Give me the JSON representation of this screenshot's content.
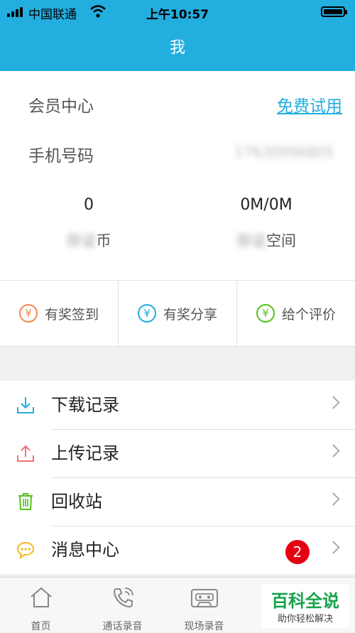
{
  "status": {
    "carrier": "中国联通",
    "time": "上午10:57"
  },
  "nav": {
    "title": "我"
  },
  "profile": {
    "member_label": "会员中心",
    "member_link": "免费试用",
    "phone_label": "手机号码",
    "phone_value": "17630996805",
    "coins": {
      "value": "0",
      "label_blur": "存证",
      "label": "币"
    },
    "space": {
      "value": "0M/0M",
      "label_blur": "存证",
      "label": "空间"
    }
  },
  "actions": [
    {
      "label": "有奖签到",
      "color": "#f08a4b"
    },
    {
      "label": "有奖分享",
      "color": "#23aee0"
    },
    {
      "label": "给个评价",
      "color": "#52c41a"
    }
  ],
  "menu": [
    {
      "label": "下载记录",
      "icon": "download-icon",
      "color": "#23aee0"
    },
    {
      "label": "上传记录",
      "icon": "upload-icon",
      "color": "#f0707a"
    },
    {
      "label": "回收站",
      "icon": "trash-icon",
      "color": "#52c41a"
    },
    {
      "label": "消息中心",
      "icon": "message-icon",
      "color": "#f5b820",
      "badge": "2"
    }
  ],
  "tabs": [
    {
      "label": "首页",
      "icon": "home-icon"
    },
    {
      "label": "通话录音",
      "icon": "phone-call-icon"
    },
    {
      "label": "现场录音",
      "icon": "cassette-icon"
    }
  ],
  "watermark": {
    "title": "百科全说",
    "subtitle": "助你轻松解决"
  }
}
